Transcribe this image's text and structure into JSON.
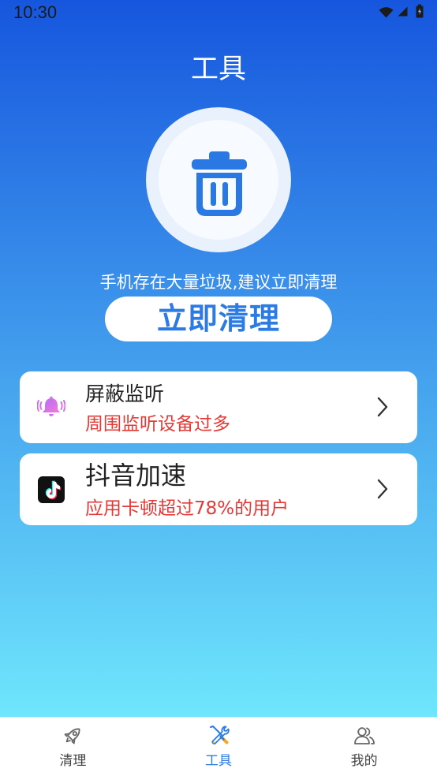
{
  "status_bar": {
    "time": "10:30",
    "icons": [
      "wifi-icon",
      "signal-icon",
      "battery-icon"
    ]
  },
  "header": {
    "title": "工具"
  },
  "hero": {
    "icon": "trash-icon",
    "message": "手机存在大量垃圾,建议立即清理",
    "button_label": "立即清理"
  },
  "tools": [
    {
      "icon": "bell-icon",
      "title": "屏蔽监听",
      "subtitle": "周围监听设备过多"
    },
    {
      "icon": "tiktok-icon",
      "title": "抖音加速",
      "subtitle": "应用卡顿超过78%的用户"
    }
  ],
  "bottom_nav": {
    "items": [
      {
        "icon": "rocket-icon",
        "label": "清理",
        "active": false
      },
      {
        "icon": "tools-icon",
        "label": "工具",
        "active": true
      },
      {
        "icon": "user-group-icon",
        "label": "我的",
        "active": false
      }
    ]
  },
  "colors": {
    "accent": "#2c7be5",
    "alert": "#e53935",
    "gradient_top": "#1656de",
    "gradient_bottom": "#6fe6fc"
  }
}
